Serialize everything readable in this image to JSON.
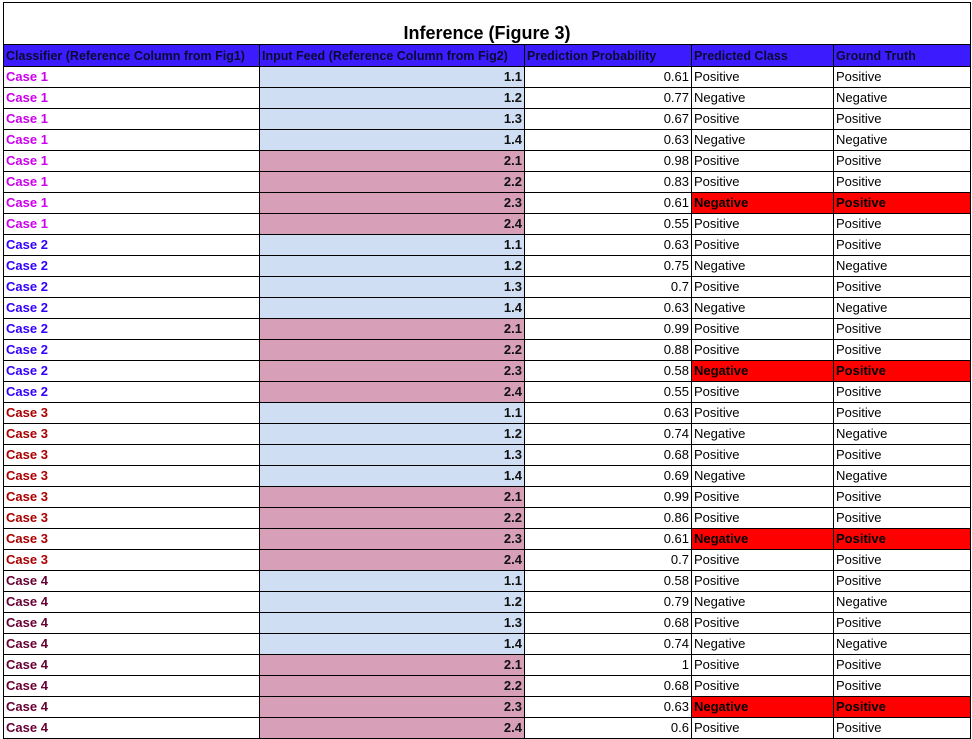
{
  "title": "Inference (Figure 3)",
  "headers": [
    "Classifier (Reference Column from Fig1)",
    "Input Feed (Reference Column from Fig2)",
    "Prediction Probability",
    "Predicted Class",
    "Ground Truth"
  ],
  "colors": {
    "header_bg": "#3c1cff",
    "feed_1x_bg": "#cfdef3",
    "feed_2x_bg": "#d8a0b8",
    "mismatch_bg": "#ff0000",
    "case1": "#cc00ee",
    "case2": "#3300ff",
    "case3": "#aa0000",
    "case4": "#660033"
  },
  "rows": [
    {
      "classifier": "Case 1",
      "feed": "1.1",
      "prob": "0.61",
      "pred": "Positive",
      "truth": "Positive"
    },
    {
      "classifier": "Case 1",
      "feed": "1.2",
      "prob": "0.77",
      "pred": "Negative",
      "truth": "Negative"
    },
    {
      "classifier": "Case 1",
      "feed": "1.3",
      "prob": "0.67",
      "pred": "Positive",
      "truth": "Positive"
    },
    {
      "classifier": "Case 1",
      "feed": "1.4",
      "prob": "0.63",
      "pred": "Negative",
      "truth": "Negative"
    },
    {
      "classifier": "Case 1",
      "feed": "2.1",
      "prob": "0.98",
      "pred": "Positive",
      "truth": "Positive"
    },
    {
      "classifier": "Case 1",
      "feed": "2.2",
      "prob": "0.83",
      "pred": "Positive",
      "truth": "Positive"
    },
    {
      "classifier": "Case 1",
      "feed": "2.3",
      "prob": "0.61",
      "pred": "Negative",
      "truth": "Positive"
    },
    {
      "classifier": "Case 1",
      "feed": "2.4",
      "prob": "0.55",
      "pred": "Positive",
      "truth": "Positive"
    },
    {
      "classifier": "Case 2",
      "feed": "1.1",
      "prob": "0.63",
      "pred": "Positive",
      "truth": "Positive"
    },
    {
      "classifier": "Case 2",
      "feed": "1.2",
      "prob": "0.75",
      "pred": "Negative",
      "truth": "Negative"
    },
    {
      "classifier": "Case 2",
      "feed": "1.3",
      "prob": "0.7",
      "pred": "Positive",
      "truth": "Positive"
    },
    {
      "classifier": "Case 2",
      "feed": "1.4",
      "prob": "0.63",
      "pred": "Negative",
      "truth": "Negative"
    },
    {
      "classifier": "Case 2",
      "feed": "2.1",
      "prob": "0.99",
      "pred": "Positive",
      "truth": "Positive"
    },
    {
      "classifier": "Case 2",
      "feed": "2.2",
      "prob": "0.88",
      "pred": "Positive",
      "truth": "Positive"
    },
    {
      "classifier": "Case 2",
      "feed": "2.3",
      "prob": "0.58",
      "pred": "Negative",
      "truth": "Positive"
    },
    {
      "classifier": "Case 2",
      "feed": "2.4",
      "prob": "0.55",
      "pred": "Positive",
      "truth": "Positive"
    },
    {
      "classifier": "Case 3",
      "feed": "1.1",
      "prob": "0.63",
      "pred": "Positive",
      "truth": "Positive"
    },
    {
      "classifier": "Case 3",
      "feed": "1.2",
      "prob": "0.74",
      "pred": "Negative",
      "truth": "Negative"
    },
    {
      "classifier": "Case 3",
      "feed": "1.3",
      "prob": "0.68",
      "pred": "Positive",
      "truth": "Positive"
    },
    {
      "classifier": "Case 3",
      "feed": "1.4",
      "prob": "0.69",
      "pred": "Negative",
      "truth": "Negative"
    },
    {
      "classifier": "Case 3",
      "feed": "2.1",
      "prob": "0.99",
      "pred": "Positive",
      "truth": "Positive"
    },
    {
      "classifier": "Case 3",
      "feed": "2.2",
      "prob": "0.86",
      "pred": "Positive",
      "truth": "Positive"
    },
    {
      "classifier": "Case 3",
      "feed": "2.3",
      "prob": "0.61",
      "pred": "Negative",
      "truth": "Positive"
    },
    {
      "classifier": "Case 3",
      "feed": "2.4",
      "prob": "0.7",
      "pred": "Positive",
      "truth": "Positive"
    },
    {
      "classifier": "Case 4",
      "feed": "1.1",
      "prob": "0.58",
      "pred": "Positive",
      "truth": "Positive"
    },
    {
      "classifier": "Case 4",
      "feed": "1.2",
      "prob": "0.79",
      "pred": "Negative",
      "truth": "Negative"
    },
    {
      "classifier": "Case 4",
      "feed": "1.3",
      "prob": "0.68",
      "pred": "Positive",
      "truth": "Positive"
    },
    {
      "classifier": "Case 4",
      "feed": "1.4",
      "prob": "0.74",
      "pred": "Negative",
      "truth": "Negative"
    },
    {
      "classifier": "Case 4",
      "feed": "2.1",
      "prob": "1",
      "pred": "Positive",
      "truth": "Positive"
    },
    {
      "classifier": "Case 4",
      "feed": "2.2",
      "prob": "0.68",
      "pred": "Positive",
      "truth": "Positive"
    },
    {
      "classifier": "Case 4",
      "feed": "2.3",
      "prob": "0.63",
      "pred": "Negative",
      "truth": "Positive"
    },
    {
      "classifier": "Case 4",
      "feed": "2.4",
      "prob": "0.6",
      "pred": "Positive",
      "truth": "Positive"
    }
  ]
}
